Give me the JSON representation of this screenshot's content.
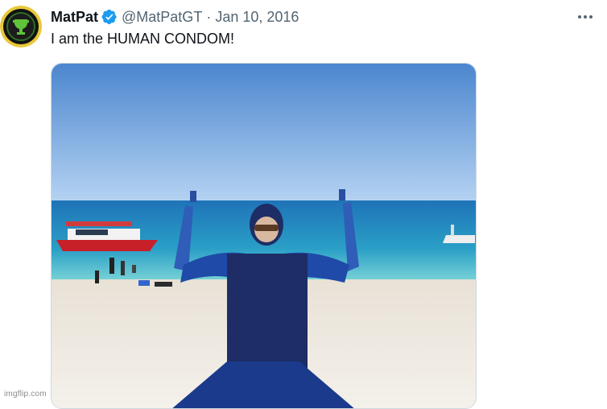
{
  "tweet": {
    "display_name": "MatPat",
    "handle": "@MatPatGT",
    "separator": "·",
    "date": "Jan 10, 2016",
    "text": "I am the HUMAN CONDOM!"
  },
  "icons": {
    "avatar": "game-theory-logo",
    "verified": "verified-badge-icon",
    "more": "more-options-icon"
  },
  "colors": {
    "verified_blue": "#1d9bf0",
    "handle_gray": "#536471",
    "text": "#0f1419"
  },
  "watermark": "imgflip.com"
}
